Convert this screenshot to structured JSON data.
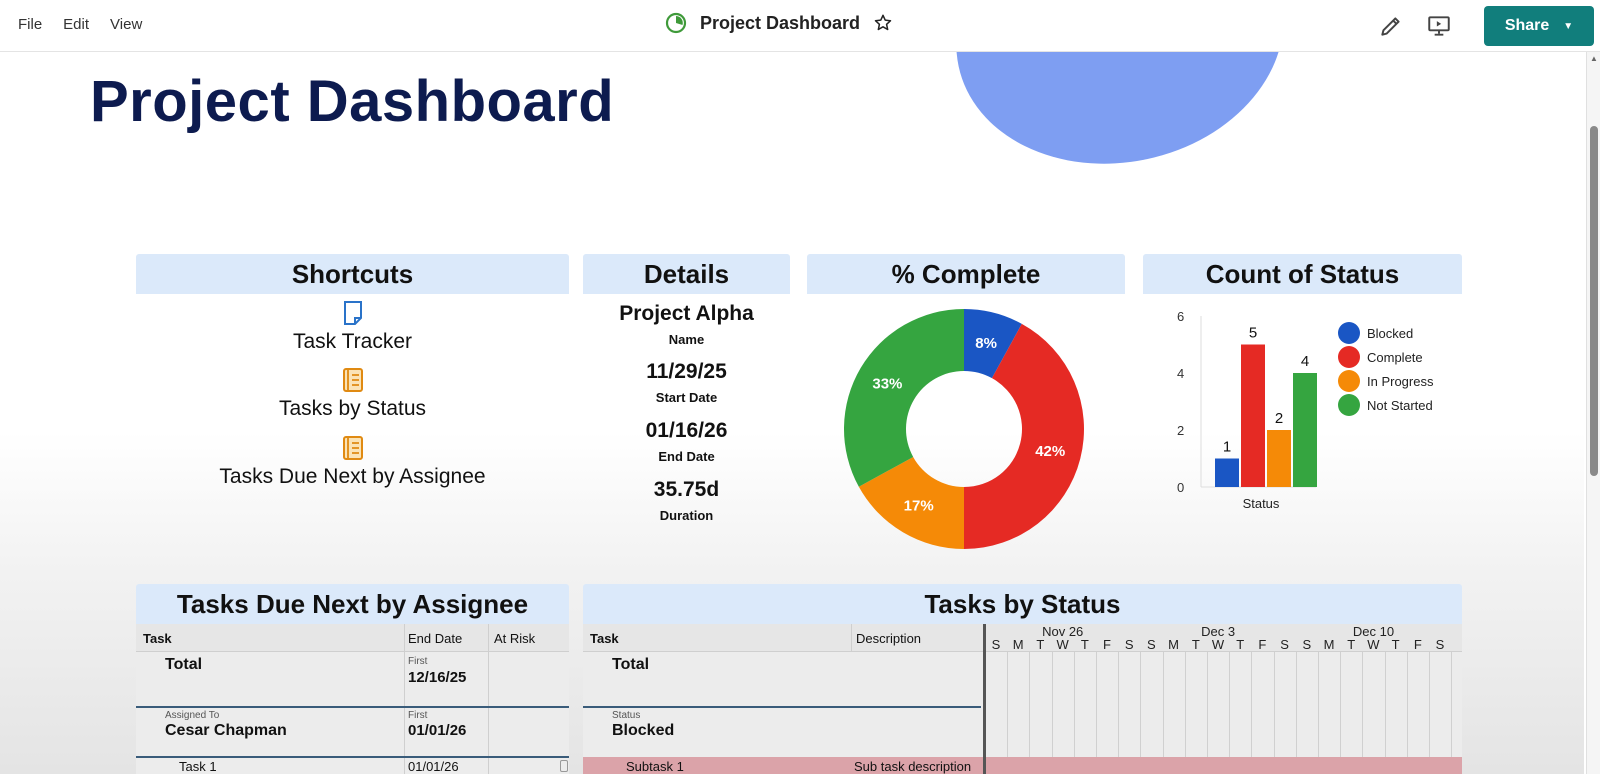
{
  "menu": {
    "file": "File",
    "edit": "Edit",
    "view": "View"
  },
  "doc": {
    "title": "Project Dashboard"
  },
  "share": {
    "label": "Share"
  },
  "page_title": "Project Dashboard",
  "shortcuts": {
    "title": "Shortcuts",
    "items": [
      {
        "label": "Task Tracker",
        "icon": "sheet-icon"
      },
      {
        "label": "Tasks by Status",
        "icon": "report-icon"
      },
      {
        "label": "Tasks Due Next by Assignee",
        "icon": "report-icon"
      }
    ]
  },
  "details": {
    "title": "Details",
    "items": [
      {
        "value": "Project Alpha",
        "label": "Name"
      },
      {
        "value": "11/29/25",
        "label": "Start Date"
      },
      {
        "value": "01/16/26",
        "label": "End Date"
      },
      {
        "value": "35.75d",
        "label": "Duration"
      }
    ]
  },
  "colors": {
    "blocked": "#1a56c4",
    "complete": "#e52a24",
    "in_progress": "#f58a07",
    "not_started": "#35a540",
    "accent": "#117e7c",
    "header_bg": "#dbe9fa"
  },
  "chart_data": [
    {
      "type": "pie",
      "title": "% Complete",
      "slices": [
        {
          "label": "Blocked",
          "value": 8,
          "text": "8%"
        },
        {
          "label": "Complete",
          "value": 42,
          "text": "42%"
        },
        {
          "label": "In Progress",
          "value": 17,
          "text": "17%"
        },
        {
          "label": "Not Started",
          "value": 33,
          "text": "33%"
        }
      ]
    },
    {
      "type": "bar",
      "title": "Count of Status",
      "xlabel": "Status",
      "categories": [
        "Blocked",
        "Complete",
        "In Progress",
        "Not Started"
      ],
      "values": [
        1,
        5,
        2,
        4
      ],
      "ylim": [
        0,
        6
      ],
      "yticks": [
        "0",
        "2",
        "4",
        "6"
      ],
      "legend": "right"
    }
  ],
  "assignee_table": {
    "title": "Tasks Due Next by Assignee",
    "headers": {
      "task": "Task",
      "end_date": "End Date",
      "at_risk": "At Risk"
    },
    "total": {
      "label": "Total",
      "end_caption": "First",
      "end_value": "12/16/25"
    },
    "group": {
      "caption": "Assigned To",
      "name": "Cesar Chapman",
      "end_caption": "First",
      "end_value": "01/01/26"
    },
    "row": {
      "task": "Task 1",
      "end_date": "01/01/26"
    }
  },
  "status_table": {
    "title": "Tasks by Status",
    "headers": {
      "task": "Task",
      "description": "Description"
    },
    "weeks": [
      "Nov 26",
      "Dec 3",
      "Dec 10"
    ],
    "days": [
      "S",
      "M",
      "T",
      "W",
      "T",
      "F",
      "S",
      "S",
      "M",
      "T",
      "W",
      "T",
      "F",
      "S",
      "S",
      "M",
      "T",
      "W",
      "T",
      "F",
      "S"
    ],
    "total": {
      "label": "Total"
    },
    "group": {
      "caption": "Status",
      "name": "Blocked"
    },
    "row": {
      "task": "Subtask 1",
      "description": "Sub task description"
    }
  }
}
